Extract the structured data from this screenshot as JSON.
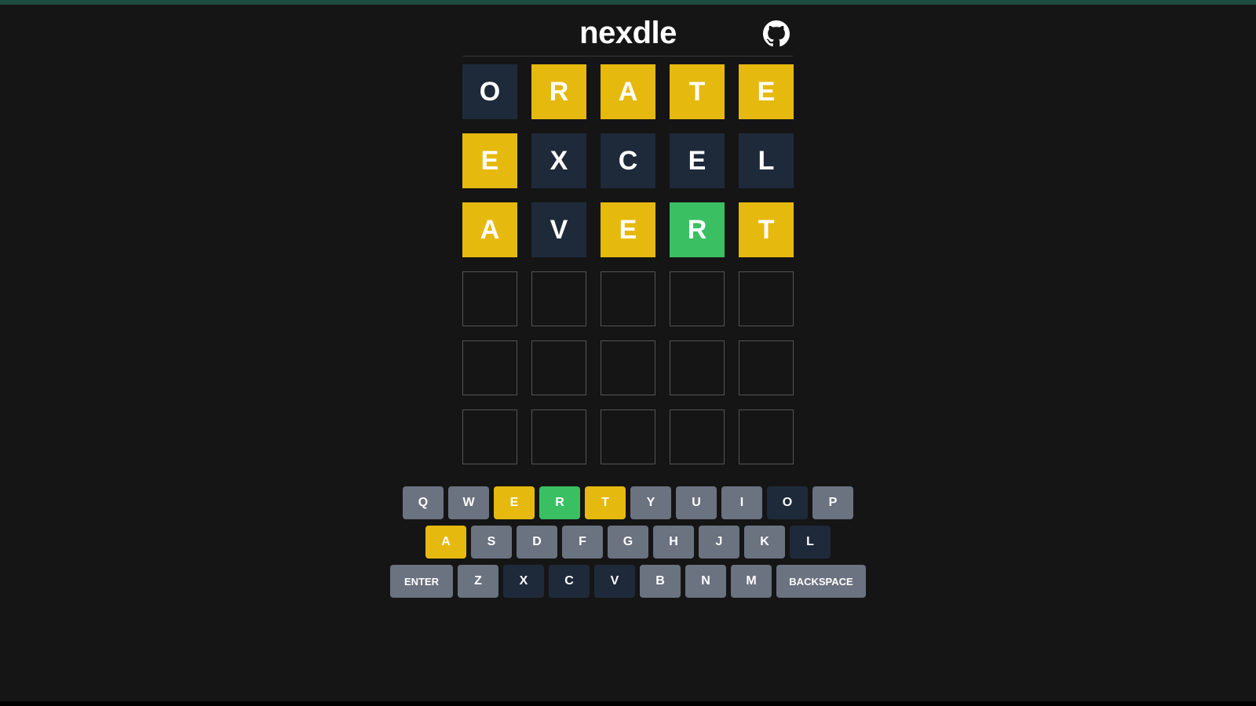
{
  "header": {
    "title": "nexdle",
    "github_link": true
  },
  "board": {
    "rows": 6,
    "cols": 5,
    "guesses": [
      [
        {
          "letter": "O",
          "state": "absent"
        },
        {
          "letter": "R",
          "state": "present"
        },
        {
          "letter": "A",
          "state": "present"
        },
        {
          "letter": "T",
          "state": "present"
        },
        {
          "letter": "E",
          "state": "present"
        }
      ],
      [
        {
          "letter": "E",
          "state": "present"
        },
        {
          "letter": "X",
          "state": "absent"
        },
        {
          "letter": "C",
          "state": "absent"
        },
        {
          "letter": "E",
          "state": "absent"
        },
        {
          "letter": "L",
          "state": "absent"
        }
      ],
      [
        {
          "letter": "A",
          "state": "present"
        },
        {
          "letter": "V",
          "state": "absent"
        },
        {
          "letter": "E",
          "state": "present"
        },
        {
          "letter": "R",
          "state": "correct"
        },
        {
          "letter": "T",
          "state": "present"
        }
      ],
      [
        {
          "letter": "",
          "state": "empty"
        },
        {
          "letter": "",
          "state": "empty"
        },
        {
          "letter": "",
          "state": "empty"
        },
        {
          "letter": "",
          "state": "empty"
        },
        {
          "letter": "",
          "state": "empty"
        }
      ],
      [
        {
          "letter": "",
          "state": "empty"
        },
        {
          "letter": "",
          "state": "empty"
        },
        {
          "letter": "",
          "state": "empty"
        },
        {
          "letter": "",
          "state": "empty"
        },
        {
          "letter": "",
          "state": "empty"
        }
      ],
      [
        {
          "letter": "",
          "state": "empty"
        },
        {
          "letter": "",
          "state": "empty"
        },
        {
          "letter": "",
          "state": "empty"
        },
        {
          "letter": "",
          "state": "empty"
        },
        {
          "letter": "",
          "state": "empty"
        }
      ]
    ]
  },
  "keyboard": {
    "rows": [
      [
        {
          "label": "Q",
          "state": "unused"
        },
        {
          "label": "W",
          "state": "unused"
        },
        {
          "label": "E",
          "state": "present"
        },
        {
          "label": "R",
          "state": "correct"
        },
        {
          "label": "T",
          "state": "present"
        },
        {
          "label": "Y",
          "state": "unused"
        },
        {
          "label": "U",
          "state": "unused"
        },
        {
          "label": "I",
          "state": "unused"
        },
        {
          "label": "O",
          "state": "absent"
        },
        {
          "label": "P",
          "state": "unused"
        }
      ],
      [
        {
          "label": "A",
          "state": "present"
        },
        {
          "label": "S",
          "state": "unused"
        },
        {
          "label": "D",
          "state": "unused"
        },
        {
          "label": "F",
          "state": "unused"
        },
        {
          "label": "G",
          "state": "unused"
        },
        {
          "label": "H",
          "state": "unused"
        },
        {
          "label": "J",
          "state": "unused"
        },
        {
          "label": "K",
          "state": "unused"
        },
        {
          "label": "L",
          "state": "absent"
        }
      ],
      [
        {
          "label": "ENTER",
          "state": "unused",
          "size": "wide"
        },
        {
          "label": "Z",
          "state": "unused"
        },
        {
          "label": "X",
          "state": "absent"
        },
        {
          "label": "C",
          "state": "absent"
        },
        {
          "label": "V",
          "state": "absent"
        },
        {
          "label": "B",
          "state": "unused"
        },
        {
          "label": "N",
          "state": "unused"
        },
        {
          "label": "M",
          "state": "unused"
        },
        {
          "label": "BACKSPACE",
          "state": "unused",
          "size": "xwide"
        }
      ]
    ]
  }
}
